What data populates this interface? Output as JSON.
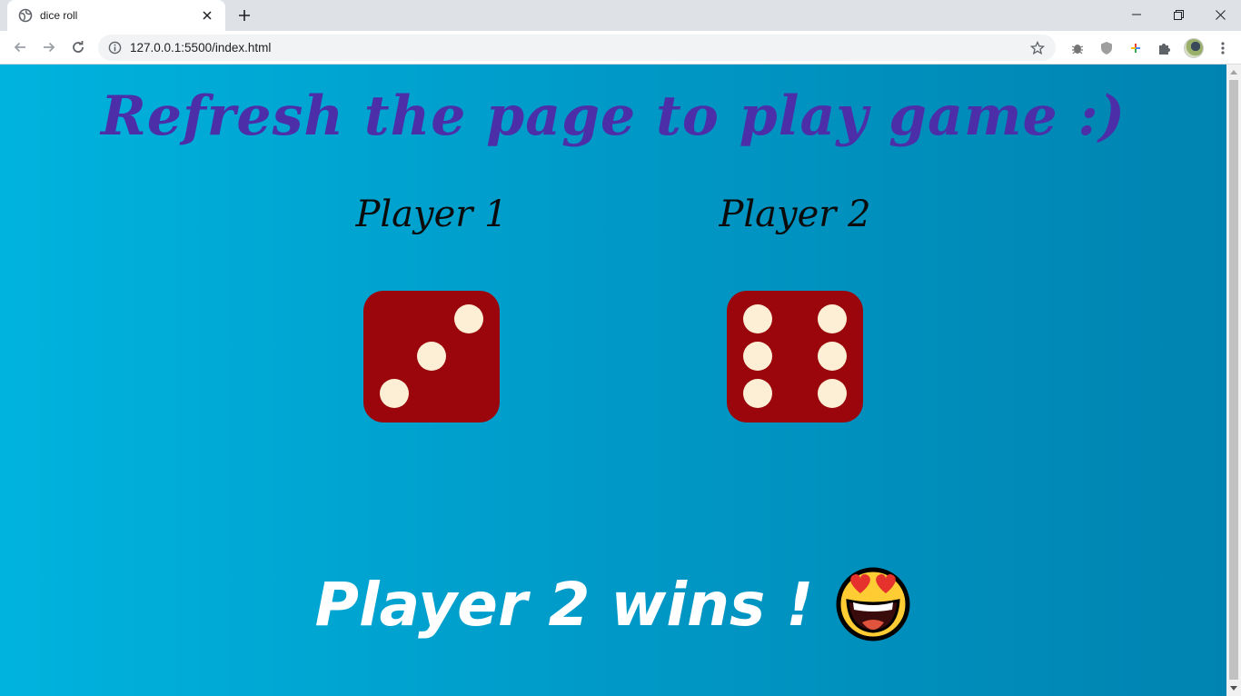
{
  "browser": {
    "tab": {
      "title": "dice roll",
      "favicon": "globe-icon"
    },
    "url": "127.0.0.1:5500/index.html",
    "icons": {
      "back": "arrow-left-icon",
      "forward": "arrow-right-icon",
      "reload": "reload-icon",
      "info": "info-icon",
      "bookmark": "star-icon",
      "extensions": [
        "bug-extension-icon",
        "shield-extension-icon",
        "plus-extension-icon",
        "puzzle-icon"
      ],
      "menu": "kebab-menu-icon"
    }
  },
  "page": {
    "headline": "Refresh the page to play game :)",
    "players": [
      {
        "label": "Player 1",
        "die_value": 3
      },
      {
        "label": "Player 2",
        "die_value": 6
      }
    ],
    "result": "Player 2 wins !",
    "result_emoji": "heart-eyes-emoji"
  },
  "colors": {
    "background_start": "#00b3de",
    "background_end": "#0083b0",
    "headline": "#4c2fa8",
    "die": "#9b060c",
    "pip": "#fcefd6",
    "result_text": "#ffffff"
  }
}
